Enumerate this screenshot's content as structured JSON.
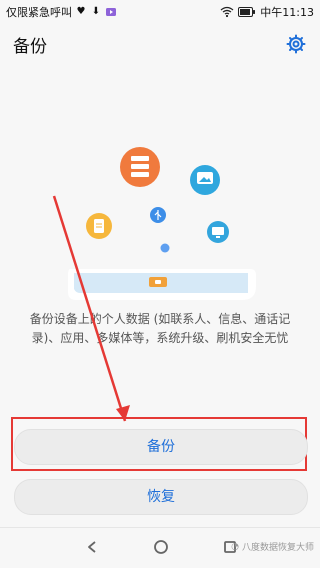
{
  "status_bar": {
    "left_text": "仅限紧急呼叫",
    "time": "中午11:13",
    "icons": [
      "heart-rate-icon",
      "download-icon",
      "video-icon",
      "wifi-icon",
      "battery-icon"
    ]
  },
  "header": {
    "title": "备份",
    "settings_icon": "gear-icon"
  },
  "main": {
    "description": "备份设备上的个人数据 (如联系人、信息、通话记录)、应用、多媒体等，系统升级、刷机安全无忧",
    "primary_button": "备份",
    "secondary_button": "恢复"
  },
  "navigation": {
    "back_icon": "back-icon",
    "home_icon": "home-icon",
    "recent_icon": "recent-apps-icon"
  },
  "watermark": "八度数据恢复大师",
  "colors": {
    "accent": "#1f6fd9",
    "annotation": "#e53935",
    "button_bg": "#ececec",
    "page_bg": "#f7f7f7"
  }
}
